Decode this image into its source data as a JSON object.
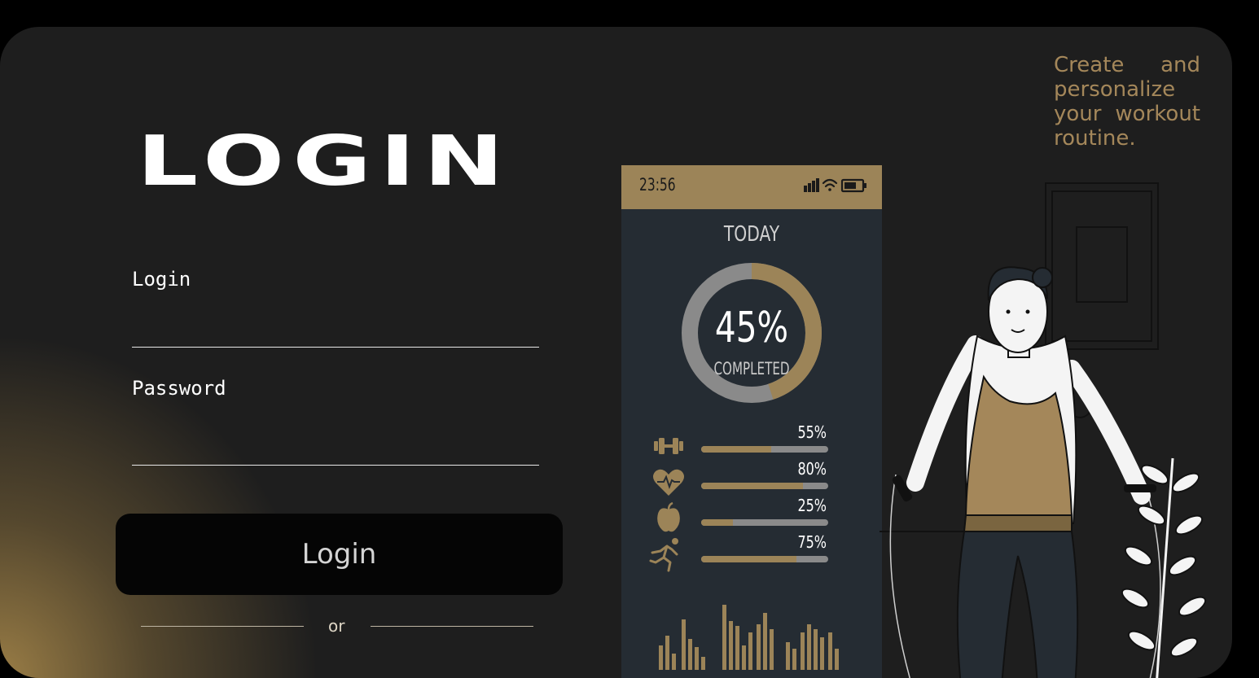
{
  "login": {
    "title": "LOGIN",
    "login_label": "Login",
    "login_value": "",
    "password_label": "Password",
    "password_value": "",
    "submit_label": "Login",
    "divider_text": "or"
  },
  "tagline": "Create and personalize your workout routine.",
  "phone": {
    "time": "23:56",
    "status_icons": [
      "signal-icon",
      "wifi-icon",
      "battery-icon"
    ],
    "heading": "TODAY",
    "progress_value": "45%",
    "progress_fraction": 0.45,
    "progress_label": "COMPLETED",
    "stats": [
      {
        "icon": "dumbbell-icon",
        "pct_text": "55%",
        "fraction": 0.55
      },
      {
        "icon": "heart-rate-icon",
        "pct_text": "80%",
        "fraction": 0.8
      },
      {
        "icon": "apple-icon",
        "pct_text": "25%",
        "fraction": 0.25
      },
      {
        "icon": "runner-icon",
        "pct_text": "75%",
        "fraction": 0.75
      }
    ]
  },
  "colors": {
    "accent": "#9c8458",
    "accent_text": "#a4875a",
    "card_bg": "#1e1e1e",
    "phone_bg": "#252c33",
    "track": "#8a8a8a",
    "button_bg": "#050505"
  }
}
